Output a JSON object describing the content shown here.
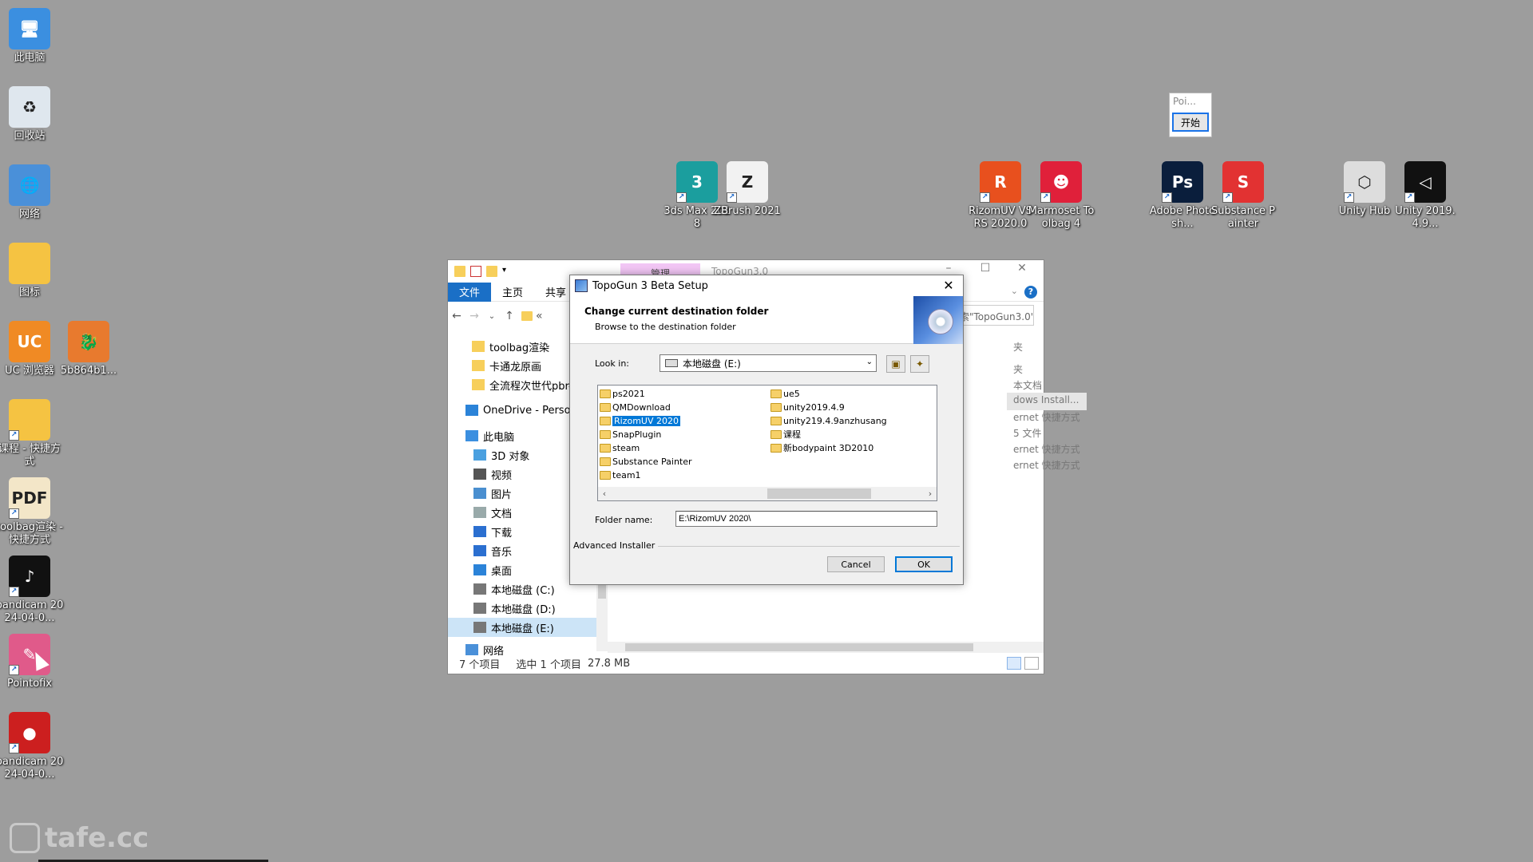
{
  "desktop": {
    "icons": [
      {
        "label": "此电脑",
        "icon": "computer-icon",
        "color": "#3b8fe0"
      },
      {
        "label": "回收站",
        "icon": "recycle-bin-icon",
        "color": "#dfe7ee"
      },
      {
        "label": "网络",
        "icon": "network-icon",
        "color": "#4a90d9"
      },
      {
        "label": "图标",
        "icon": "folder-icon",
        "color": "#f5c342"
      },
      {
        "label": "UC 浏览器",
        "icon": "uc-browser-icon",
        "color": "#f08a24"
      },
      {
        "label": "5b864b1...",
        "icon": "image-file-icon",
        "color": "#e87a2e"
      },
      {
        "label": "课程 - 快捷方式",
        "icon": "folder-shortcut-icon",
        "color": "#f5c342"
      },
      {
        "label": "toolbag渲染 - 快捷方式",
        "icon": "pdf-shortcut-icon",
        "color": "#f3e6c8"
      },
      {
        "label": "bandicam 2024-04-0...",
        "icon": "tiktok-icon",
        "color": "#111111"
      },
      {
        "label": "Pointofix",
        "icon": "pointofix-icon",
        "color": "#e05a8a"
      },
      {
        "label": "bandicam 2024-04-0...",
        "icon": "bandicam-icon",
        "color": "#cc1f1f"
      },
      {
        "label": "3ds Max 2018",
        "icon": "3ds-max-icon",
        "color": "#1b9e9e"
      },
      {
        "label": "ZBrush 2021",
        "icon": "zbrush-icon",
        "color": "#f2f2f2"
      },
      {
        "label": "RizomUV VS RS 2020.0",
        "icon": "rizomuv-icon",
        "color": "#e8501e"
      },
      {
        "label": "Marmoset Toolbag 4",
        "icon": "marmoset-icon",
        "color": "#e0203a"
      },
      {
        "label": "Adobe Photosh...",
        "icon": "photoshop-icon",
        "color": "#0a1e3c"
      },
      {
        "label": "Substance Painter",
        "icon": "substance-painter-icon",
        "color": "#e23232"
      },
      {
        "label": "Unity Hub",
        "icon": "unity-hub-icon",
        "color": "#dddddd"
      },
      {
        "label": "Unity 2019.4.9...",
        "icon": "unity-icon",
        "color": "#111111"
      }
    ]
  },
  "pointofix_mini": {
    "title": "Poi...",
    "start_label": "开始"
  },
  "explorer": {
    "manage_tab": "管理",
    "title": "TopoGun3.0",
    "ribbon_tabs": [
      "文件",
      "主页",
      "共享"
    ],
    "breadcrumb_prefix": "«",
    "search_placeholder": "索\"TopoGun3.0\"",
    "nav_items": [
      {
        "label": "toolbag渲染",
        "icon": "folder-icon"
      },
      {
        "label": "卡通龙原画",
        "icon": "folder-icon"
      },
      {
        "label": "全流程次世代pbr-",
        "icon": "folder-icon"
      },
      {
        "label": "OneDrive - Person",
        "icon": "onedrive-icon"
      },
      {
        "label": "此电脑",
        "icon": "computer-icon"
      },
      {
        "label": "3D 对象",
        "icon": "3d-objects-icon"
      },
      {
        "label": "视频",
        "icon": "video-icon"
      },
      {
        "label": "图片",
        "icon": "picture-icon"
      },
      {
        "label": "文档",
        "icon": "document-icon"
      },
      {
        "label": "下载",
        "icon": "download-icon"
      },
      {
        "label": "音乐",
        "icon": "music-icon"
      },
      {
        "label": "桌面",
        "icon": "desktop-icon"
      },
      {
        "label": "本地磁盘 (C:)",
        "icon": "drive-icon"
      },
      {
        "label": "本地磁盘 (D:)",
        "icon": "drive-icon"
      },
      {
        "label": "本地磁盘 (E:)",
        "icon": "drive-icon"
      },
      {
        "label": "网络",
        "icon": "network-icon"
      }
    ],
    "right_fragments": [
      "夹",
      "夹",
      "本文档",
      "dows Install...",
      "ernet 快捷方式",
      "5 文件",
      "ernet 快捷方式",
      "ernet 快捷方式"
    ],
    "status": {
      "count": "7 个项目",
      "selected": "选中 1 个项目",
      "size": "27.8 MB"
    }
  },
  "setup": {
    "title": "TopoGun 3 Beta Setup",
    "header_title": "Change current destination folder",
    "header_sub": "Browse to the destination folder",
    "look_in_label": "Look in:",
    "look_in_value": "本地磁盘 (E:)",
    "folders_col1": [
      "ps2021",
      "QMDownload",
      "RizomUV 2020",
      "SnapPlugin",
      "steam",
      "Substance Painter",
      "team1"
    ],
    "folders_col2": [
      "ue5",
      "unity2019.4.9",
      "unity219.4.9anzhusang",
      "课程",
      "新bodypaint 3D2010"
    ],
    "selected_folder": "RizomUV 2020",
    "folder_name_label": "Folder name:",
    "folder_name_value": "E:\\RizomUV 2020\\",
    "advanced_label": "Advanced Installer",
    "cancel_label": "Cancel",
    "ok_label": "OK",
    "accent": "#0078d7"
  },
  "watermark": "tafe.cc"
}
